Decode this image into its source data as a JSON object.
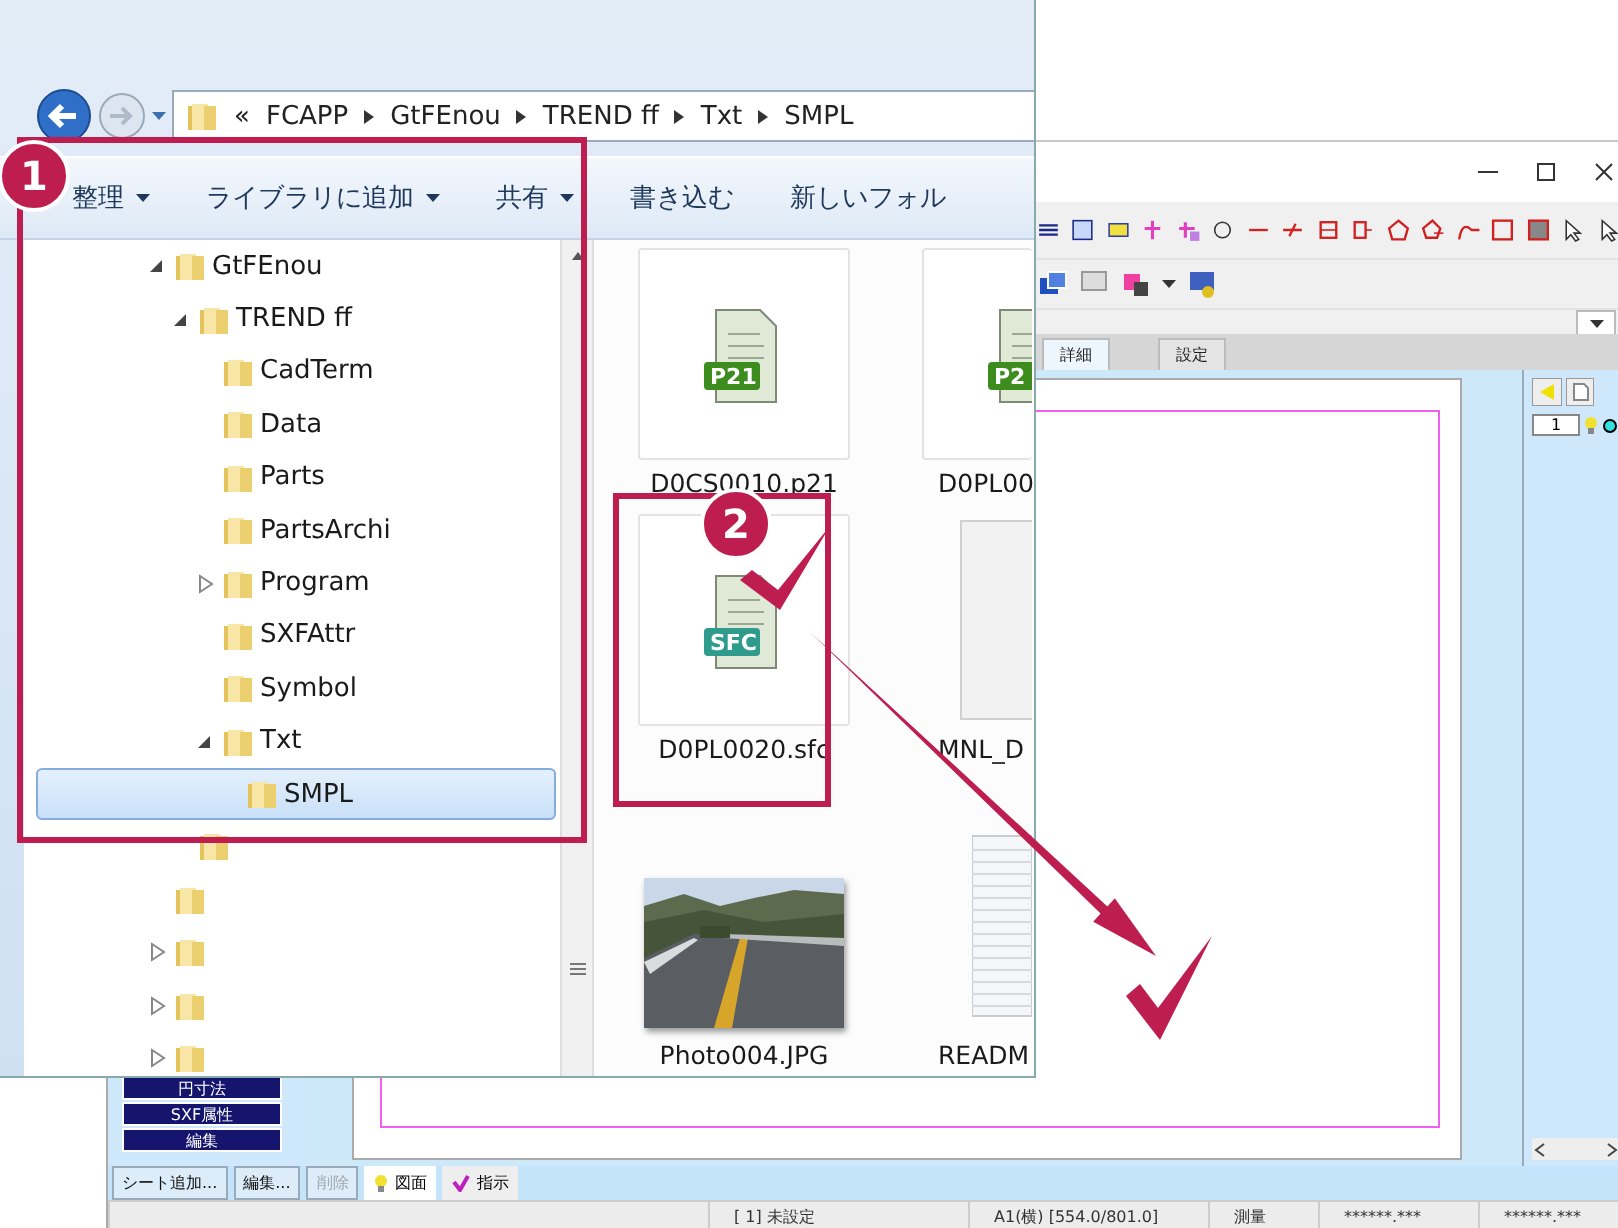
{
  "explorer": {
    "address_prefix": "«",
    "address": [
      "FCAPP",
      "GtFEnou",
      "TREND ff",
      "Txt",
      "SMPL"
    ],
    "commands": [
      {
        "label": "整理",
        "menu": true
      },
      {
        "label": "ライブラリに追加",
        "menu": true
      },
      {
        "label": "共有",
        "menu": true
      },
      {
        "label": "書き込む",
        "menu": false
      },
      {
        "label": "新しいフォル",
        "menu": false
      }
    ],
    "tree": [
      {
        "label": "GtFEnou",
        "expanded": true,
        "selected": false,
        "children": [
          {
            "label": "TREND ff",
            "expanded": true,
            "selected": false,
            "children": [
              {
                "label": "CadTerm",
                "selected": false
              },
              {
                "label": "Data",
                "selected": false
              },
              {
                "label": "Parts",
                "selected": false
              },
              {
                "label": "PartsArchi",
                "selected": false
              },
              {
                "label": "Program",
                "expanded": false,
                "selected": false
              },
              {
                "label": "SXFAttr",
                "selected": false
              },
              {
                "label": "Symbol",
                "selected": false
              },
              {
                "label": "Txt",
                "expanded": true,
                "selected": false,
                "children": [
                  {
                    "label": "SMPL",
                    "selected": true
                  }
                ]
              }
            ]
          }
        ]
      }
    ],
    "files": [
      {
        "name": "D0CS0010.p21",
        "kind": "p21",
        "badge": "P21"
      },
      {
        "name": "D0PL00",
        "kind": "p21",
        "badge": "P2"
      },
      {
        "name": "D0PL0020.sfc",
        "kind": "sfc",
        "badge": "SFC"
      },
      {
        "name": "MNL_D",
        "kind": "blank"
      },
      {
        "name": "Photo004.JPG",
        "kind": "picture"
      },
      {
        "name": "READM",
        "kind": "text"
      }
    ]
  },
  "cad": {
    "tabs": [
      {
        "label": "詳細",
        "selected": true
      },
      {
        "label": "設定",
        "selected": false
      }
    ],
    "layer_number": "1",
    "side_buttons": [
      "円寸法",
      "SXF属性",
      "編集"
    ],
    "sheet_buttons": [
      {
        "label": "シート追加...",
        "disabled": false
      },
      {
        "label": "編集...",
        "disabled": false
      },
      {
        "label": "削除",
        "disabled": true
      }
    ],
    "view_tabs": [
      {
        "label": "図面",
        "kind": "bulb",
        "selected": true
      },
      {
        "label": "指示",
        "kind": "check",
        "selected": false
      }
    ],
    "status": [
      "[ 1] 未設定",
      "A1(横) [554.0/801.0]",
      "測量",
      "******.***",
      "******.***"
    ]
  },
  "callouts": [
    "1",
    "2"
  ]
}
